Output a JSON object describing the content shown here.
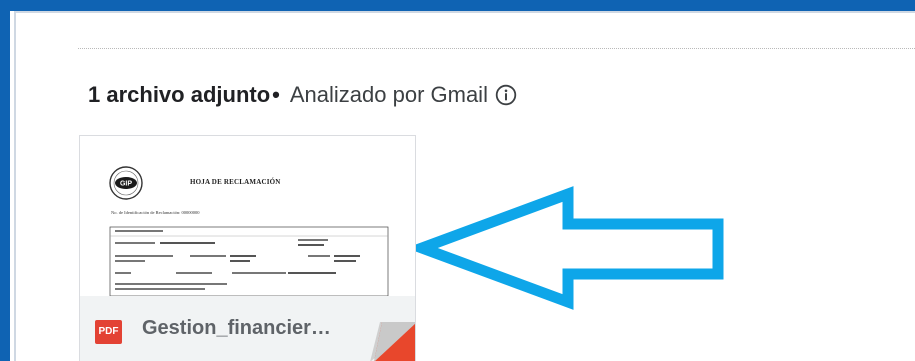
{
  "attachments": {
    "count_label": "1 archivo adjunto",
    "separator": "•",
    "scan_label": "Analizado por Gmail",
    "info_icon": "info-icon"
  },
  "attachment": {
    "file_name": "Gestion_financier…",
    "type_badge": "PDF",
    "preview": {
      "title": "HOJA DE RECLAMACIÓN",
      "reference_line": "No. de Identificación de Reclamación: 00000000"
    }
  },
  "annotation": {
    "arrow_color": "#0ea6e9",
    "arrow_direction": "left"
  },
  "colors": {
    "frame_border": "#0f63b3",
    "pdf_badge": "#e34234",
    "footer_bg": "#f1f3f4",
    "corner_fold": "#e8472c"
  }
}
